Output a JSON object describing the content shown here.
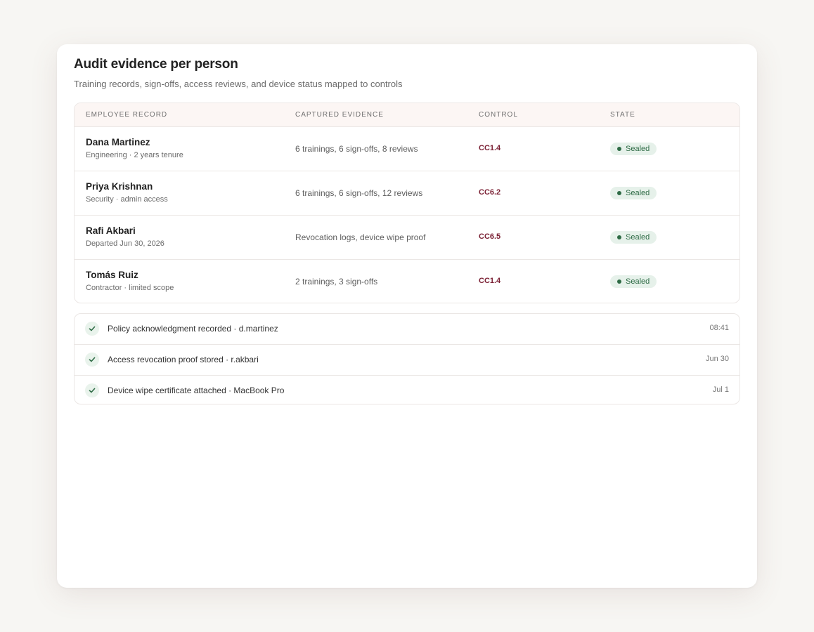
{
  "header": {
    "title": "Audit evidence per person",
    "subtitle": "Training records, sign-offs, access reviews, and device status mapped to controls"
  },
  "table": {
    "columns": [
      "EMPLOYEE RECORD",
      "CAPTURED EVIDENCE",
      "CONTROL",
      "STATE"
    ],
    "rows": [
      {
        "name": "Dana Martinez",
        "meta": "Engineering · 2 years tenure",
        "evidence": "6 trainings, 6 sign-offs, 8 reviews",
        "control": "CC1.4",
        "state": "Sealed"
      },
      {
        "name": "Priya Krishnan",
        "meta": "Security · admin access",
        "evidence": "6 trainings, 6 sign-offs, 12 reviews",
        "control": "CC6.2",
        "state": "Sealed"
      },
      {
        "name": "Rafi Akbari",
        "meta": "Departed Jun 30, 2026",
        "evidence": "Revocation logs, device wipe proof",
        "control": "CC6.5",
        "state": "Sealed"
      },
      {
        "name": "Tomás Ruiz",
        "meta": "Contractor · limited scope",
        "evidence": "2 trainings, 3 sign-offs",
        "control": "CC1.4",
        "state": "Sealed"
      }
    ]
  },
  "activity": [
    {
      "text": "Policy acknowledgment recorded · d.martinez",
      "time": "08:41",
      "icon": "check-icon"
    },
    {
      "text": "Access revocation proof stored · r.akbari",
      "time": "Jun 30",
      "icon": "check-icon"
    },
    {
      "text": "Device wipe certificate attached · MacBook Pro",
      "time": "Jul 1",
      "icon": "check-icon"
    }
  ],
  "colors": {
    "control_text": "#7a1f33",
    "badge_bg": "#e6f1ea",
    "badge_text": "#2e6b45",
    "header_bg": "#fcf6f4"
  }
}
